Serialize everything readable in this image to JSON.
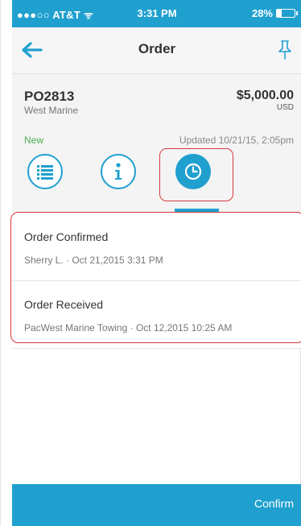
{
  "status_bar": {
    "carrier": "●●●○○ AT&T ᯤ",
    "time": "3:31 PM",
    "battery": "28%",
    "battery_level": 0.28
  },
  "nav": {
    "title": "Order",
    "back_icon": "arrow-left-icon",
    "pin_icon": "pin-icon"
  },
  "order": {
    "po_number": "PO2813",
    "vendor": "West Marine",
    "amount": "$5,000.00",
    "currency": "USD",
    "status": "New",
    "updated": "Updated 10/21/15, 2:05pm"
  },
  "tabs": [
    {
      "name": "details",
      "icon": "list-icon",
      "active": false
    },
    {
      "name": "info",
      "icon": "info-icon",
      "active": false
    },
    {
      "name": "history",
      "icon": "clock-icon",
      "active": true
    }
  ],
  "history": [
    {
      "title": "Order Confirmed",
      "meta": "Sherry L. · Oct 21,2015 3:31 PM"
    },
    {
      "title": "Order Received",
      "meta": "PacWest Marine Towing · Oct 12,2015 10:25 AM"
    }
  ],
  "bottom_bar": {
    "confirm_label": "Confirm"
  },
  "colors": {
    "accent": "#1fa0cf",
    "status_new": "#4caf50",
    "highlight": "#d9373f"
  }
}
